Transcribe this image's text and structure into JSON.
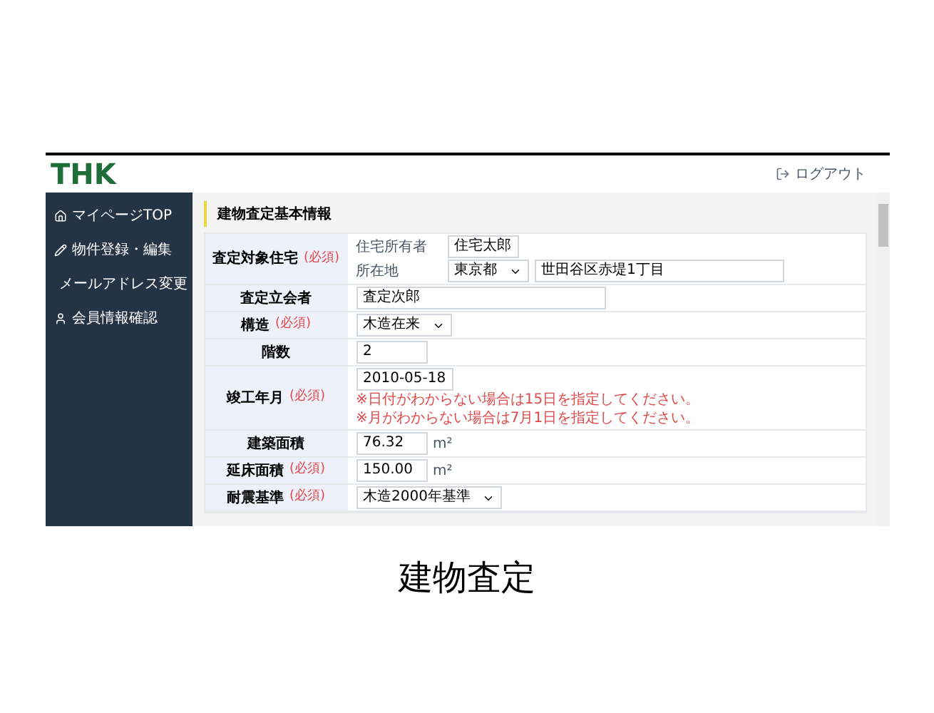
{
  "header": {
    "logo": "THK",
    "logout": "ログアウト"
  },
  "sidebar": {
    "items": [
      {
        "label": "マイページTOP"
      },
      {
        "label": "物件登録・編集"
      },
      {
        "label": "メールアドレス変更"
      },
      {
        "label": "会員情報確認"
      }
    ]
  },
  "section_title": "建物査定基本情報",
  "form": {
    "rows": [
      {
        "label": "査定対象住宅",
        "required": "(必須)",
        "lines": [
          [
            {
              "kind": "caption",
              "text": "住宅所有者"
            },
            {
              "kind": "short-input",
              "text": "住宅太郎"
            }
          ],
          [
            {
              "kind": "caption",
              "text": "所在地"
            },
            {
              "kind": "select",
              "text": "東京都"
            },
            {
              "kind": "long-input",
              "text": "世田谷区赤堤1丁目"
            }
          ]
        ]
      },
      {
        "label": "査定立会者",
        "lines": [
          [
            {
              "kind": "long-input",
              "text": "査定次郎"
            }
          ]
        ]
      },
      {
        "label": "構造",
        "required": "(必須)",
        "lines": [
          [
            {
              "kind": "select",
              "text": "木造在来"
            }
          ]
        ]
      },
      {
        "label": "階数",
        "lines": [
          [
            {
              "kind": "short-input",
              "text": "2"
            }
          ]
        ]
      },
      {
        "label": "竣工年月",
        "required": "(必須)",
        "lines": [
          [
            {
              "kind": "short-input",
              "text": "2010-05-18"
            }
          ],
          [
            {
              "kind": "note",
              "text": "※日付がわからない場合は15日を指定してください。"
            }
          ],
          [
            {
              "kind": "note",
              "text": "※月がわからない場合は7月1日を指定してください。"
            }
          ]
        ]
      },
      {
        "label": "建築面積",
        "lines": [
          [
            {
              "kind": "short-input",
              "text": "76.32"
            },
            {
              "kind": "unit",
              "text": "m²"
            }
          ]
        ]
      },
      {
        "label": "延床面積",
        "required": "(必須)",
        "lines": [
          [
            {
              "kind": "short-input",
              "text": "150.00"
            },
            {
              "kind": "unit",
              "text": "m²"
            }
          ]
        ]
      },
      {
        "label": "耐震基準",
        "required": "(必須)",
        "lines": [
          [
            {
              "kind": "select",
              "text": "木造2000年基準"
            }
          ]
        ]
      }
    ]
  },
  "caption": "建物査定"
}
